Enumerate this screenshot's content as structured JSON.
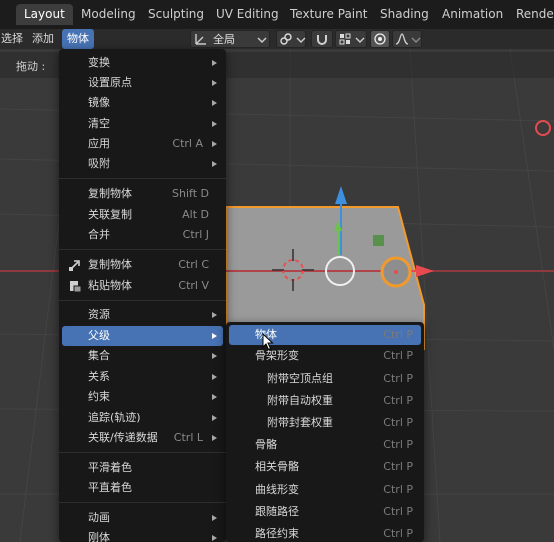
{
  "workspace_tabs": [
    "Layout",
    "Modeling",
    "Sculpting",
    "UV Editing",
    "Texture Paint",
    "Shading",
    "Animation",
    "Render"
  ],
  "header": {
    "menus": [
      "选择",
      "添加",
      "物体"
    ],
    "transform_orientation": "全局"
  },
  "tool_settings": {
    "drag_label": "拖动 :"
  },
  "object_menu": {
    "items": [
      {
        "label": "变换",
        "shortcut": "",
        "submenu": true
      },
      {
        "label": "设置原点",
        "shortcut": "",
        "submenu": true
      },
      {
        "label": "镜像",
        "shortcut": "",
        "submenu": true
      },
      {
        "label": "清空",
        "shortcut": "",
        "submenu": true
      },
      {
        "label": "应用",
        "shortcut": "Ctrl A",
        "submenu": true
      },
      {
        "label": "吸附",
        "shortcut": "",
        "submenu": true
      },
      {
        "label": "复制物体",
        "shortcut": "Shift D",
        "submenu": false
      },
      {
        "label": "关联复制",
        "shortcut": "Alt D",
        "submenu": false
      },
      {
        "label": "合并",
        "shortcut": "Ctrl J",
        "submenu": false
      },
      {
        "label": "复制物体",
        "shortcut": "Ctrl C",
        "submenu": false,
        "icon": "copy-icon"
      },
      {
        "label": "粘贴物体",
        "shortcut": "Ctrl V",
        "submenu": false,
        "icon": "paste-icon"
      },
      {
        "label": "资源",
        "shortcut": "",
        "submenu": true
      },
      {
        "label": "父级",
        "shortcut": "",
        "submenu": true,
        "highlighted": true
      },
      {
        "label": "集合",
        "shortcut": "",
        "submenu": true
      },
      {
        "label": "关系",
        "shortcut": "",
        "submenu": true
      },
      {
        "label": "约束",
        "shortcut": "",
        "submenu": true
      },
      {
        "label": "追踪(轨迹)",
        "shortcut": "",
        "submenu": true
      },
      {
        "label": "关联/传递数据",
        "shortcut": "Ctrl L",
        "submenu": true
      },
      {
        "label": "平滑着色",
        "shortcut": "",
        "submenu": false
      },
      {
        "label": "平直着色",
        "shortcut": "",
        "submenu": false
      },
      {
        "label": "动画",
        "shortcut": "",
        "submenu": true
      },
      {
        "label": "刚体",
        "shortcut": "",
        "submenu": true
      }
    ]
  },
  "parent_submenu": {
    "items": [
      {
        "label": "物体",
        "shortcut": "Ctrl P",
        "highlighted": true
      },
      {
        "label": "骨架形变",
        "shortcut": "Ctrl P"
      },
      {
        "label": "附带空顶点组",
        "shortcut": "Ctrl P",
        "indent": true
      },
      {
        "label": "附带自动权重",
        "shortcut": "Ctrl P",
        "indent": true
      },
      {
        "label": "附带封套权重",
        "shortcut": "Ctrl P",
        "indent": true
      },
      {
        "label": "骨骼",
        "shortcut": "Ctrl P"
      },
      {
        "label": "相关骨骼",
        "shortcut": "Ctrl P"
      },
      {
        "label": "曲线形变",
        "shortcut": "Ctrl P"
      },
      {
        "label": "跟随路径",
        "shortcut": "Ctrl P"
      },
      {
        "label": "路径约束",
        "shortcut": "Ctrl P"
      }
    ]
  },
  "colors": {
    "highlight": "#4772b3",
    "menu_bg": "#181818",
    "selection_outline": "#f39a2d",
    "axis_x": "#e84a4f",
    "axis_y_gizmo_green": "#6cc24a",
    "axis_z": "#3d8fe0"
  }
}
